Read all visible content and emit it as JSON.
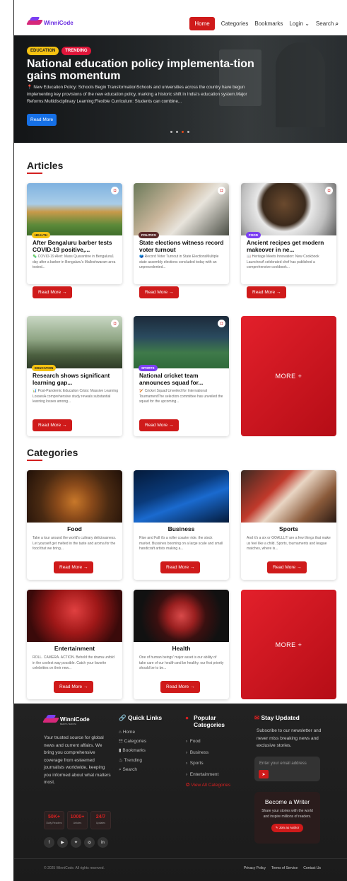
{
  "brand": {
    "name": "WinniCode",
    "tagline": "BERITA TERKINI"
  },
  "nav": {
    "home": "Home",
    "categories": "Categories",
    "bookmarks": "Bookmarks",
    "login": "Login",
    "search": "Search"
  },
  "hero": {
    "badges": [
      "EDUCATION",
      "TRENDING"
    ],
    "title": "National education policy implementa-tion gains momentum",
    "desc": "📍 New Education Policy: Schools Begin TransformationSchools and universities across the country have begun implementing key provisions of the new education policy, marking a historic shift in India's education system.Major Reforms:Multidisciplinary Learning:Flexible Curriculum: Students can combine...",
    "button": "Read More",
    "slides": 4,
    "active_slide": 2
  },
  "articles": {
    "title": "Articles",
    "items": [
      {
        "category": "HEALTH",
        "cat_color": "#f5c211",
        "title": "After Bengaluru barber tests COVID-19 positive,...",
        "desc": "🦠 COVID-19 Alert: Mass Quarantine in Bengaluru1 day after a barber in Bengaluru's Malleshwaram area tested...",
        "button": "Read More →"
      },
      {
        "category": "POLITICS",
        "cat_color": "#5a2a2a",
        "title": "State elections witness record voter turnout",
        "desc": "🗳️ Record Voter Turnout in State ElectionsMultiple state assembly elections concluded today with an unprecedented...",
        "button": "Read More →"
      },
      {
        "category": "FOOD",
        "cat_color": "#7b3ff2",
        "title": "Ancient recipes get modern makeover in ne...",
        "desc": "📖 Heritage Meets Innovation: New Cookbook LaunchesA celebrated chef has published a comprehensive cookbook...",
        "button": "Read More →"
      },
      {
        "category": "EDUCATION",
        "cat_color": "#f5c211",
        "title": "Research shows significant learning gap...",
        "desc": "📊 Post-Pandemic Education Crisis: Massive Learning LossesA comprehensive study reveals substantial learning losses among...",
        "button": "Read More →"
      },
      {
        "category": "SPORTS",
        "cat_color": "#7b3ff2",
        "title": "National cricket team announces squad for...",
        "desc": "🏏 Cricket Squad Unveiled for International TournamentThe selection committee has unveiled the squad for the upcoming...",
        "button": "Read More →"
      }
    ],
    "more": "MORE +"
  },
  "categories": {
    "title": "Categories",
    "items": [
      {
        "name": "Food",
        "desc": "Take a tour around the world's culinary deliciousness. Let yourself get melted in the taste and aroma for the food that we bring...",
        "button": "Read More →"
      },
      {
        "name": "Business",
        "desc": "Rise and Fall it's a roller coaster ride. the stock market. Bussines booming on a large scale and small handicraft artists making a...",
        "button": "Read More →"
      },
      {
        "name": "Sports",
        "desc": "And it's a six or GOALLL!!! are a few things that make us feel like a child. Sports, tournaments and league matches, where is...",
        "button": "Read More →"
      },
      {
        "name": "Entertainment",
        "desc": "ROLL. CAMERA. ACTION. Behold the drama unfold in the coolest way possible. Catch your favorite celebrities on their new...",
        "button": "Read More →"
      },
      {
        "name": "Health",
        "desc": "One of human beings' major asset is our ability of take care of our health and be healthy. our first priority should be to be...",
        "button": "Read More →"
      }
    ],
    "more": "MORE +"
  },
  "footer": {
    "about": "Your trusted source for global news and current affairs. We bring you comprehensive coverage from esteemed journalists worldwide, keeping you informed about what matters most.",
    "stats": [
      {
        "n": "50K+",
        "l": "Daily Readers"
      },
      {
        "n": "1000+",
        "l": "Articles"
      },
      {
        "n": "24/7",
        "l": "Updates"
      }
    ],
    "quick_title": "Quick Links",
    "quick": [
      "Home",
      "Categories",
      "Bookmarks",
      "Trending",
      "Search"
    ],
    "popular_title": "Popular Categories",
    "popular": [
      "Food",
      "Business",
      "Sports",
      "Entertainment"
    ],
    "view_all": "View All Categories",
    "stay_title": "Stay Updated",
    "stay_desc": "Subscribe to our newsletter and never miss breaking news and exclusive stories.",
    "email_placeholder": "Enter your email address",
    "writer_title": "Become a Writer",
    "writer_desc": "Share your stories with the world and inspire millions of readers.",
    "writer_btn": "Join as Author",
    "copyright": "© 2025 WinniCode. All rights reserved.",
    "legal": [
      "Privacy Policy",
      "Terms of Service",
      "Contact Us"
    ]
  },
  "colors": {
    "accent": "#cf1a1a",
    "hero_button": "#1670e6",
    "footer_bg": "#1e1e1e"
  }
}
